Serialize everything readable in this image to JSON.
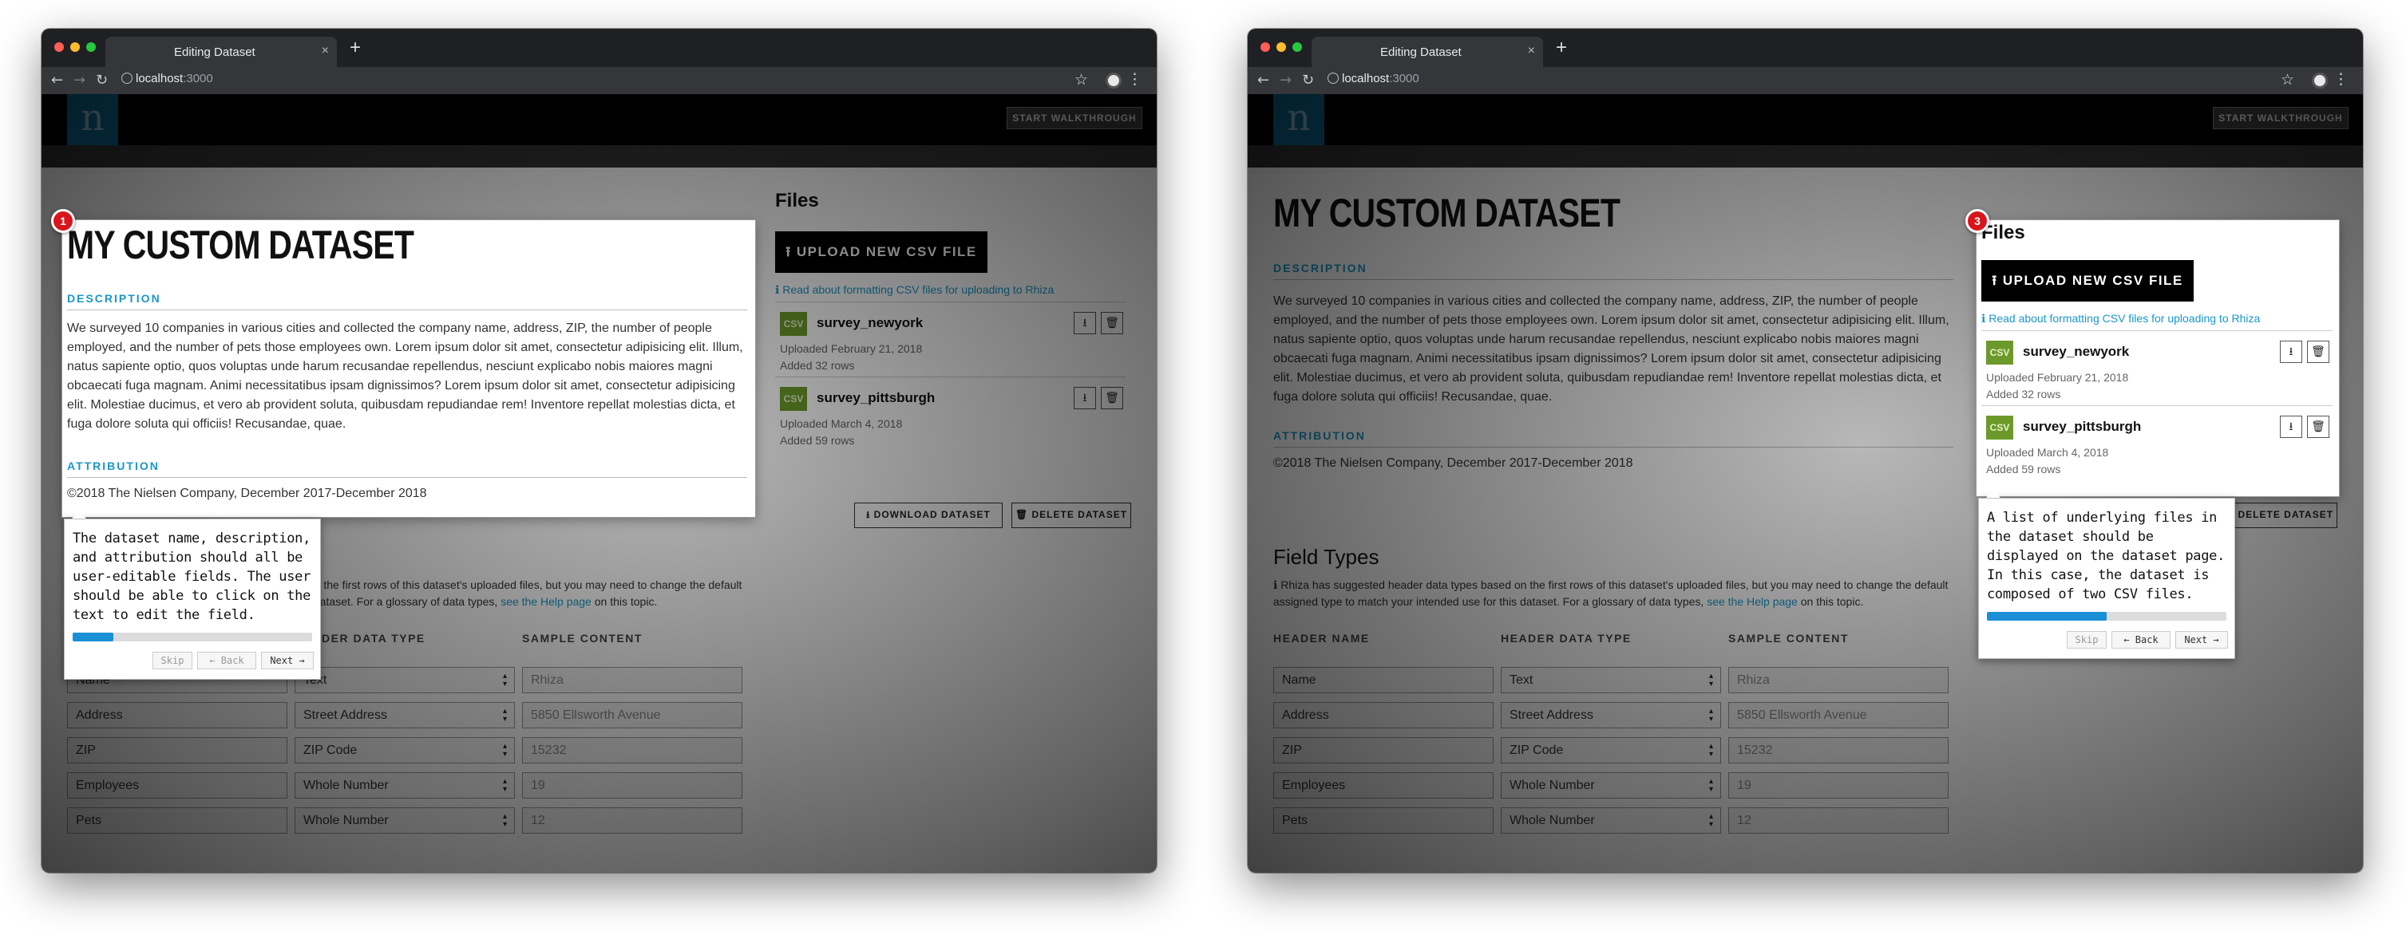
{
  "browser": {
    "tab_title": "Editing Dataset",
    "tab_close": "×",
    "new_tab": "+",
    "url_host": "localhost",
    "url_port": ":3000",
    "back": "←",
    "forward": "→",
    "reload": "↻",
    "star": "☆",
    "menu": "⋮"
  },
  "app": {
    "logo": "n",
    "walkthrough_label": "START WALKTHROUGH"
  },
  "dataset": {
    "title": "MY CUSTOM DATASET",
    "description_heading": "DESCRIPTION",
    "description": "We surveyed 10 companies in various cities and collected the company name, address, ZIP, the number of people employed, and the number of pets those employees own. Lorem ipsum dolor sit amet, consectetur adipisicing elit. Illum, natus sapiente optio, quos voluptas unde harum recusandae repellendus, nesciunt explicabo nobis maiores magni obcaecati fuga magnam. Animi necessitatibus ipsam dignissimos? Lorem ipsum dolor sit amet, consectetur adipisicing elit. Molestiae ducimus, et vero ab provident soluta, quibusdam repudiandae rem! Inventore repellat molestias dicta, et fuga dolore soluta qui officiis! Recusandae, quae.",
    "attribution_heading": "ATTRIBUTION",
    "attribution": "©2018 The Nielsen Company, December 2017-December 2018"
  },
  "field_types": {
    "heading": "Field Types",
    "note_icon": "ℹ",
    "note": "Rhiza has suggested header data types based on the first rows of this dataset's uploaded files, but you may need to change the default assigned type to match your intended use for this dataset. For a glossary of data types, ",
    "note_link": "see the Help page",
    "note_tail": " on this topic.",
    "columns": [
      "HEADER NAME",
      "HEADER DATA TYPE",
      "SAMPLE CONTENT"
    ],
    "rows": [
      {
        "name": "Name",
        "type": "Text",
        "sample": "Rhiza"
      },
      {
        "name": "Address",
        "type": "Street Address",
        "sample": "5850 Ellsworth Avenue"
      },
      {
        "name": "ZIP",
        "type": "ZIP Code",
        "sample": "15232"
      },
      {
        "name": "Employees",
        "type": "Whole Number",
        "sample": "19"
      },
      {
        "name": "Pets",
        "type": "Whole Number",
        "sample": "12"
      }
    ]
  },
  "files": {
    "heading": "Files",
    "upload_label": "⭱ UPLOAD NEW CSV FILE",
    "read_about": "ℹ Read about formatting CSV files for uploading to Rhiza",
    "items": [
      {
        "badge": "CSV",
        "name": "survey_newyork",
        "uploaded": "Uploaded February 21, 2018",
        "rows": "Added 32 rows"
      },
      {
        "badge": "CSV",
        "name": "survey_pittsburgh",
        "uploaded": "Uploaded March 4, 2018",
        "rows": "Added 59 rows"
      }
    ],
    "download_icon": "⭳",
    "delete_icon": "🗑",
    "download_dataset": "⭳ DOWNLOAD DATASET",
    "delete_dataset": "🗑 DELETE DATASET"
  },
  "walkthrough": {
    "steps": [
      {
        "number": "1",
        "text": "The dataset name, description, and attribution should all be user-editable fields. The user should be able to click on the text to edit the field.",
        "progress": 0.17
      },
      {
        "number": "3",
        "text": "A list of underlying files in the dataset should be displayed on the dataset page. In this case, the dataset is composed of two CSV files.",
        "progress": 0.5
      }
    ],
    "skip": "Skip",
    "back": "← Back",
    "next": "Next →"
  },
  "colors": {
    "accent": "#1a97c8",
    "logo_bg": "#0b6690",
    "csv_badge": "#6c9a2a",
    "badge_red": "#d8151b",
    "progress": "#1a8fd6"
  }
}
